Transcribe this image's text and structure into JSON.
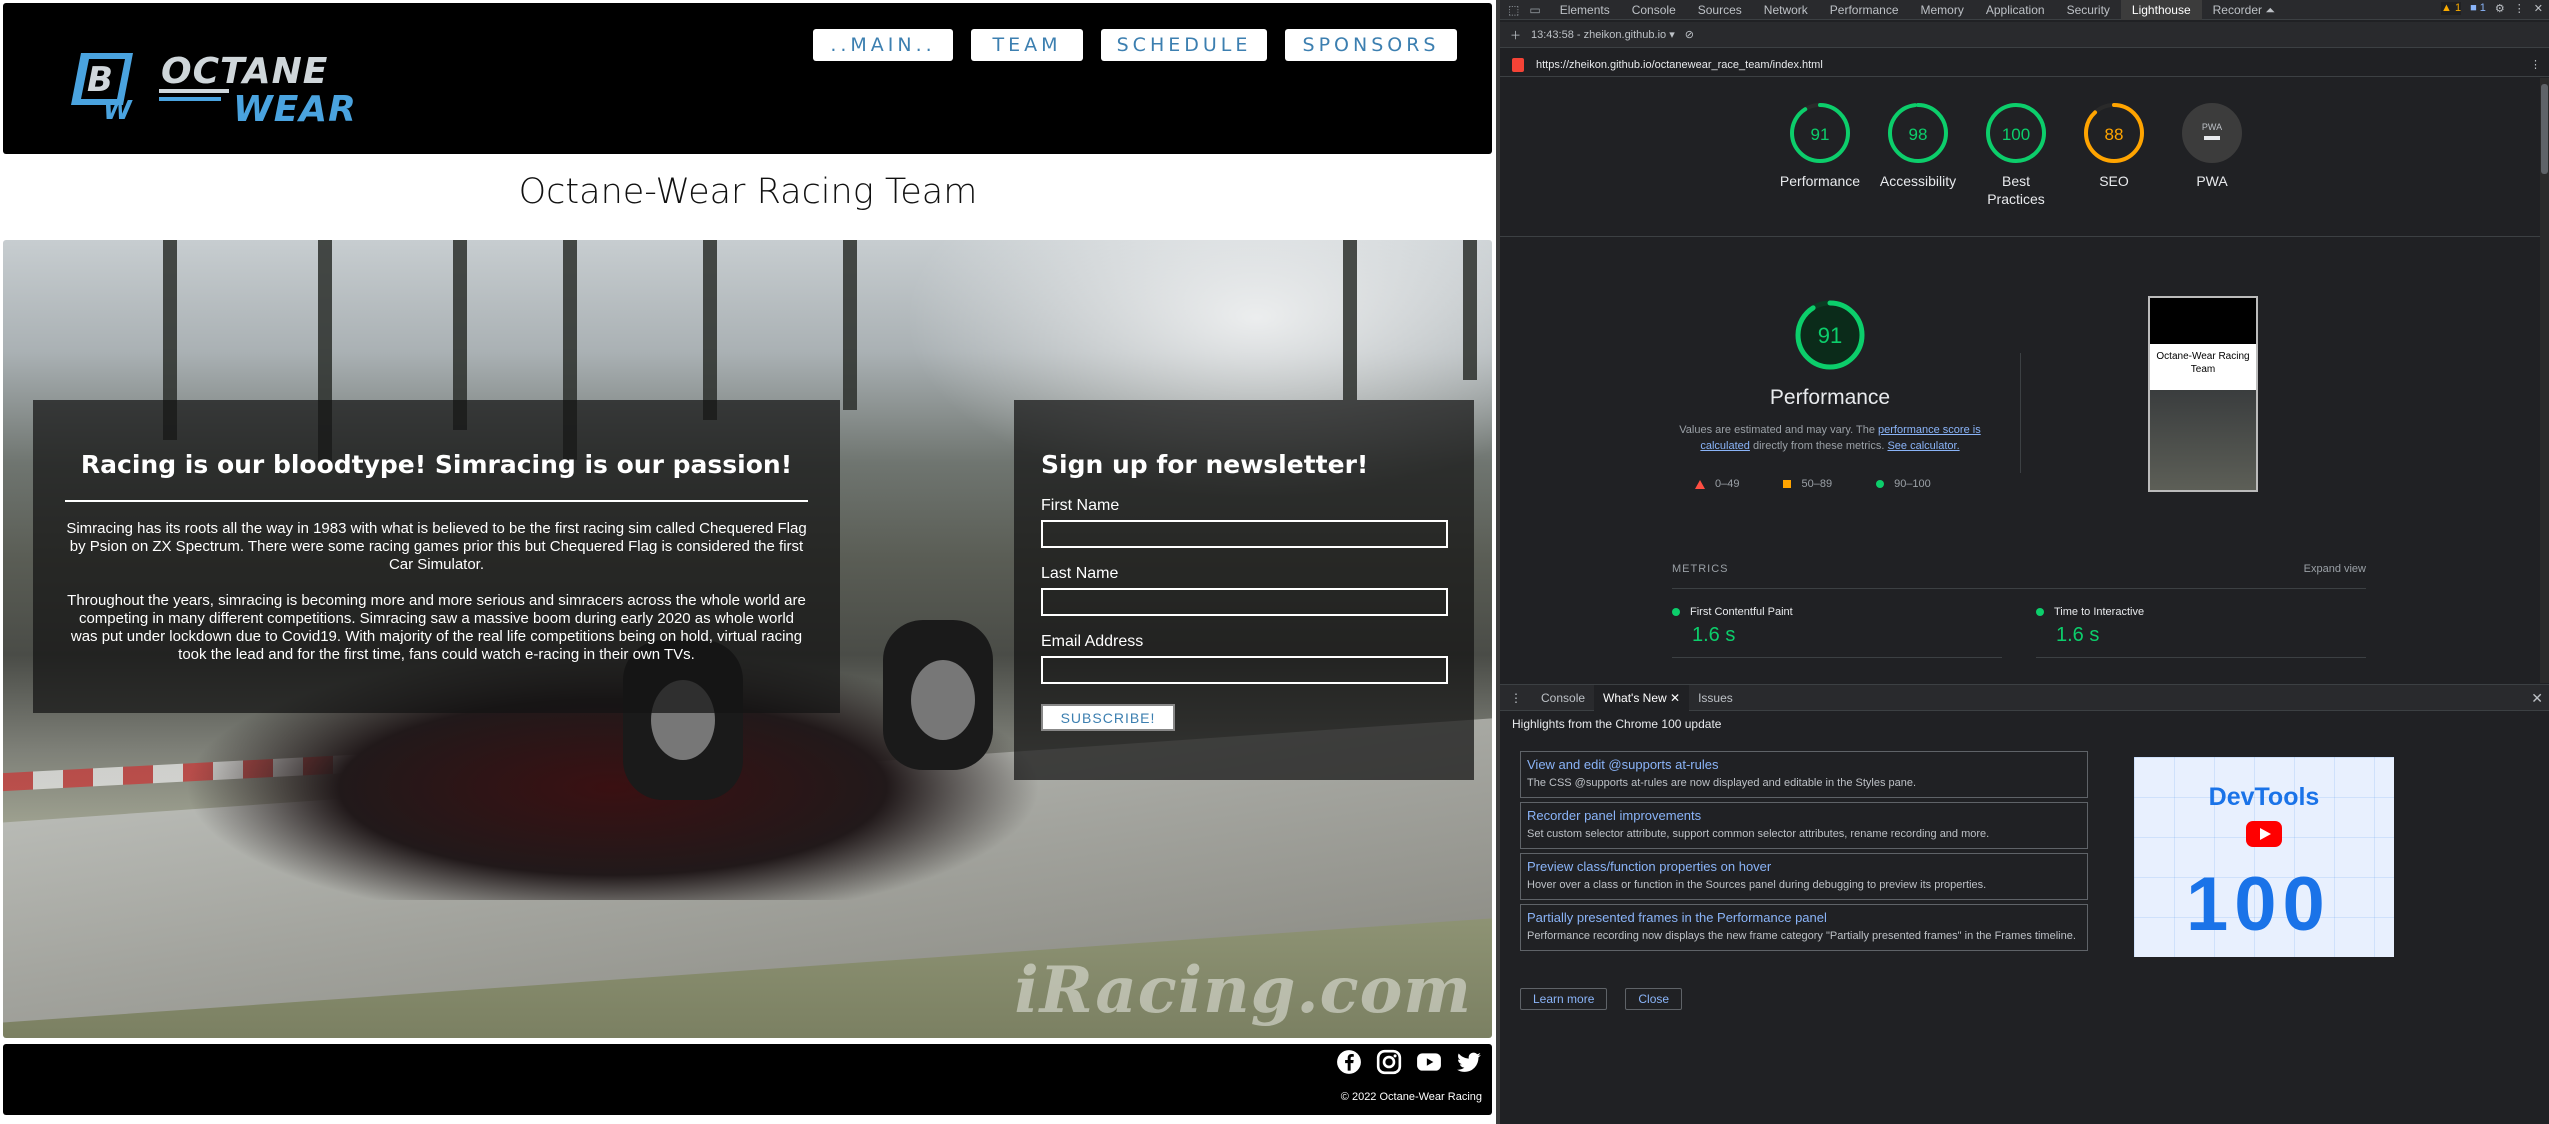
{
  "site": {
    "logo_alt": "Octane Wear",
    "logo_text_top": "OCTANE",
    "logo_text_bottom": "WEAR",
    "nav": [
      "..MAIN..",
      "TEAM",
      "SCHEDULE",
      "SPONSORS"
    ],
    "page_title": "Octane-Wear Racing Team",
    "watermark": "iRacing.com",
    "about": {
      "title": "Racing is our bloodtype! Simracing is our passion!",
      "p1": "Simracing has its roots all the way in 1983 with what is believed to be the first racing sim called Chequered Flag by Psion on ZX Spectrum. There were some racing games prior this but Chequered Flag is considered the first Car Simulator.",
      "p2": "Throughout the years, simracing is becoming more and more serious and simracers across the whole world are competing in many different competitions. Simracing saw a massive boom during early 2020 as whole world was put under lockdown due to Covid19. With majority of the real life competitions being on hold, virtual racing took the lead and for the first time, fans could watch e-racing in their own TVs."
    },
    "newsletter": {
      "title": "Sign up for newsletter!",
      "first_name_label": "First Name",
      "last_name_label": "Last Name",
      "email_label": "Email Address",
      "subscribe_label": "SUBSCRIBE!"
    },
    "footer": {
      "socials": [
        "facebook-icon",
        "instagram-icon",
        "youtube-icon",
        "twitter-icon"
      ],
      "copyright": "© 2022 Octane-Wear Racing"
    }
  },
  "devtools": {
    "tabs": [
      "Elements",
      "Console",
      "Sources",
      "Network",
      "Performance",
      "Memory",
      "Application",
      "Security",
      "Lighthouse",
      "Recorder ⏶"
    ],
    "active_tab": "Lighthouse",
    "warnings_count": "1",
    "messages_count": "1",
    "toolbar_time": "13:43:58 - zheikon.github.io",
    "report_url": "https://zheikon.github.io/octanewear_race_team/index.html",
    "gauges": [
      {
        "label": "Performance",
        "score": "91",
        "color": "#0cce6b"
      },
      {
        "label": "Accessibility",
        "score": "98",
        "color": "#0cce6b"
      },
      {
        "label": "Best Practices",
        "score": "100",
        "color": "#0cce6b"
      },
      {
        "label": "SEO",
        "score": "88",
        "color": "#ffa400"
      },
      {
        "label": "PWA",
        "score": "PWA",
        "color": "#9aa0a6"
      }
    ],
    "performance": {
      "score": "91",
      "title": "Performance",
      "note_start": "Values are estimated and may vary. The ",
      "note_link1": "performance score is calculated",
      "note_mid": " directly from these metrics. ",
      "note_link2": "See calculator."
    },
    "legend": [
      "0–49",
      "50–89",
      "90–100"
    ],
    "preview_title": "Octane-Wear Racing Team",
    "metrics_label": "METRICS",
    "expand_label": "Expand view",
    "metrics": [
      {
        "name": "First Contentful Paint",
        "value": "1.6 s"
      },
      {
        "name": "Time to Interactive",
        "value": "1.6 s"
      }
    ],
    "drawer": {
      "tabs": [
        "Console",
        "What's New",
        "Issues"
      ],
      "active_tab": "What's New",
      "heading": "Highlights from the Chrome 100 update",
      "items": [
        {
          "title": "View and edit @supports at-rules",
          "desc": "The CSS @supports at-rules are now displayed and editable in the Styles pane."
        },
        {
          "title": "Recorder panel improvements",
          "desc": "Set custom selector attribute, support common selector attributes, rename recording and more."
        },
        {
          "title": "Preview class/function properties on hover",
          "desc": "Hover over a class or function in the Sources panel during debugging to preview its properties."
        },
        {
          "title": "Partially presented frames in the Performance panel",
          "desc": "Performance recording now displays the new frame category \"Partially presented frames\" in the Frames timeline."
        }
      ],
      "learn_more": "Learn more",
      "close": "Close",
      "promo_title": "DevTools",
      "promo_number": "100"
    }
  }
}
